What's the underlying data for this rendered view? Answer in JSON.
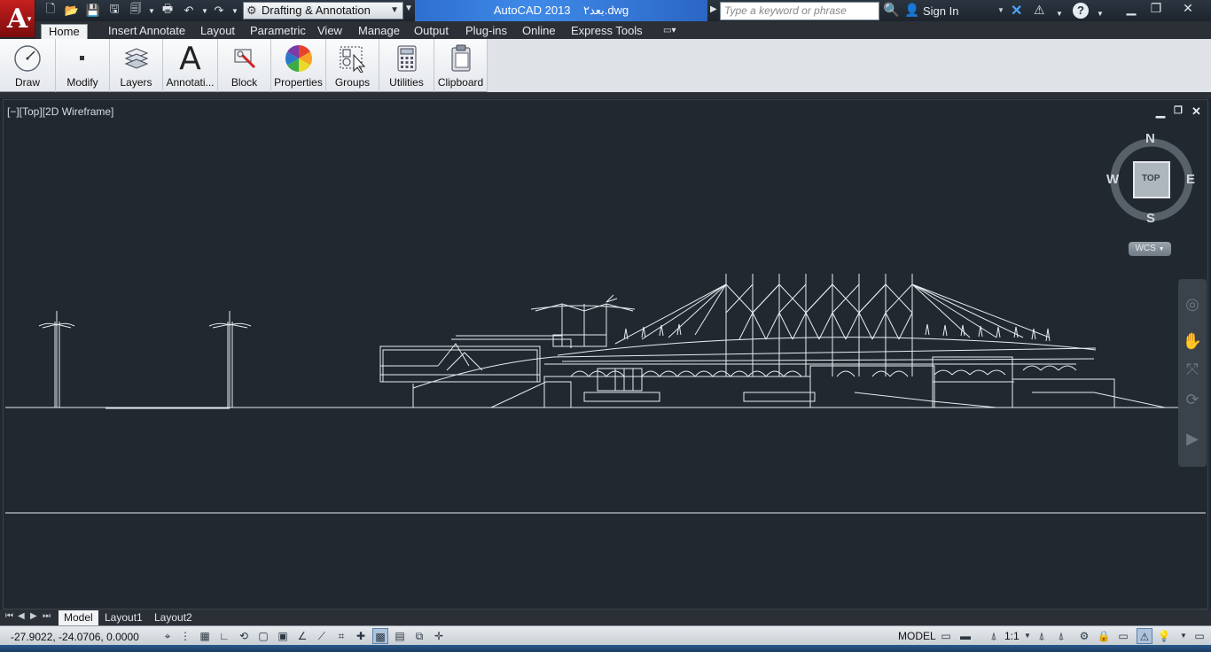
{
  "title": {
    "app_title": "AutoCAD 2013",
    "file_name": "بعد۲.dwg",
    "workspace": "Drafting & Annotation",
    "search_placeholder": "Type a keyword or phrase",
    "sign_in": "Sign In"
  },
  "ribbon_tabs": [
    "Home",
    "Insert",
    "Annotate",
    "Layout",
    "Parametric",
    "View",
    "Manage",
    "Output",
    "Plug-ins",
    "Online",
    "Express Tools"
  ],
  "ribbon_panels": [
    "Draw",
    "Modify",
    "Layers",
    "Annotati...",
    "Block",
    "Properties",
    "Groups",
    "Utilities",
    "Clipboard"
  ],
  "viewport": {
    "label": "[−][Top][2D Wireframe]",
    "viewcube": {
      "north": "N",
      "south": "S",
      "east": "E",
      "west": "W",
      "face": "TOP"
    },
    "wcs": "WCS"
  },
  "layout_tabs": [
    "Model",
    "Layout1",
    "Layout2"
  ],
  "status": {
    "coords": "-27.9022, -24.0706, 0.0000",
    "model": "MODEL",
    "scale": "1:1"
  },
  "colors": {
    "canvas": "#212830",
    "accent": "#3f8ae8",
    "app_button": "#c62020"
  }
}
